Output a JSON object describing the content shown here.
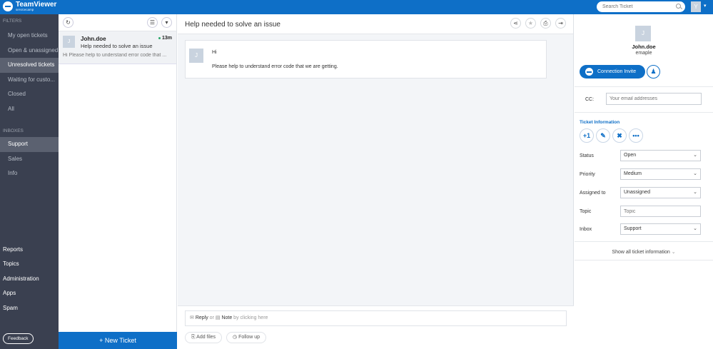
{
  "app": {
    "logo_name": "TeamViewer",
    "logo_sub": "servicecamp",
    "search_placeholder": "Search Ticket",
    "user_initial": "Y"
  },
  "nav": {
    "filters_label": "FILTERS",
    "filters": [
      {
        "label": "My open tickets"
      },
      {
        "label": "Open & unassigned"
      },
      {
        "label": "Unresolved tickets"
      },
      {
        "label": "Waiting for custo..."
      },
      {
        "label": "Closed"
      },
      {
        "label": "All"
      }
    ],
    "inboxes_label": "INBOXES",
    "inboxes": [
      {
        "label": "Support"
      },
      {
        "label": "Sales"
      },
      {
        "label": "Info"
      }
    ],
    "bottom": [
      {
        "label": "Reports"
      },
      {
        "label": "Topics"
      },
      {
        "label": "Administration"
      },
      {
        "label": "Apps"
      },
      {
        "label": "Spam"
      }
    ],
    "feedback": "Feedback"
  },
  "ticket_list": {
    "items": [
      {
        "avatar": "J",
        "name": "John.doe",
        "time": "13m",
        "subject": "Help needed to solve an issue",
        "preview": "Hi Please help to understand error code that ..."
      }
    ],
    "new_ticket": "+ New Ticket"
  },
  "main": {
    "title": "Help needed to solve an issue",
    "message": {
      "avatar": "J",
      "line1": "Hi",
      "line2": "Please help to understand error code that we are getting."
    },
    "composer": {
      "reply": "Reply",
      "or": " or ",
      "note": "Note",
      "hint": " by clicking here",
      "add_files": "Add files",
      "follow_up": "Follow up"
    }
  },
  "right": {
    "avatar": "J",
    "name": "John.doe",
    "email": "emaple",
    "connection_invite": "Connection Invite",
    "cc_label": "CC:",
    "cc_placeholder": "Your email addresses",
    "ticket_info_title": "Ticket Information",
    "plus_one": "+1",
    "fields": {
      "status_label": "Status",
      "status_value": "Open",
      "priority_label": "Priority",
      "priority_value": "Medium",
      "assigned_label": "Assigned to",
      "assigned_value": "Unassigned",
      "topic_label": "Topic",
      "topic_placeholder": "Topic",
      "inbox_label": "Inbox",
      "inbox_value": "Support"
    },
    "show_all": "Show all ticket information"
  }
}
